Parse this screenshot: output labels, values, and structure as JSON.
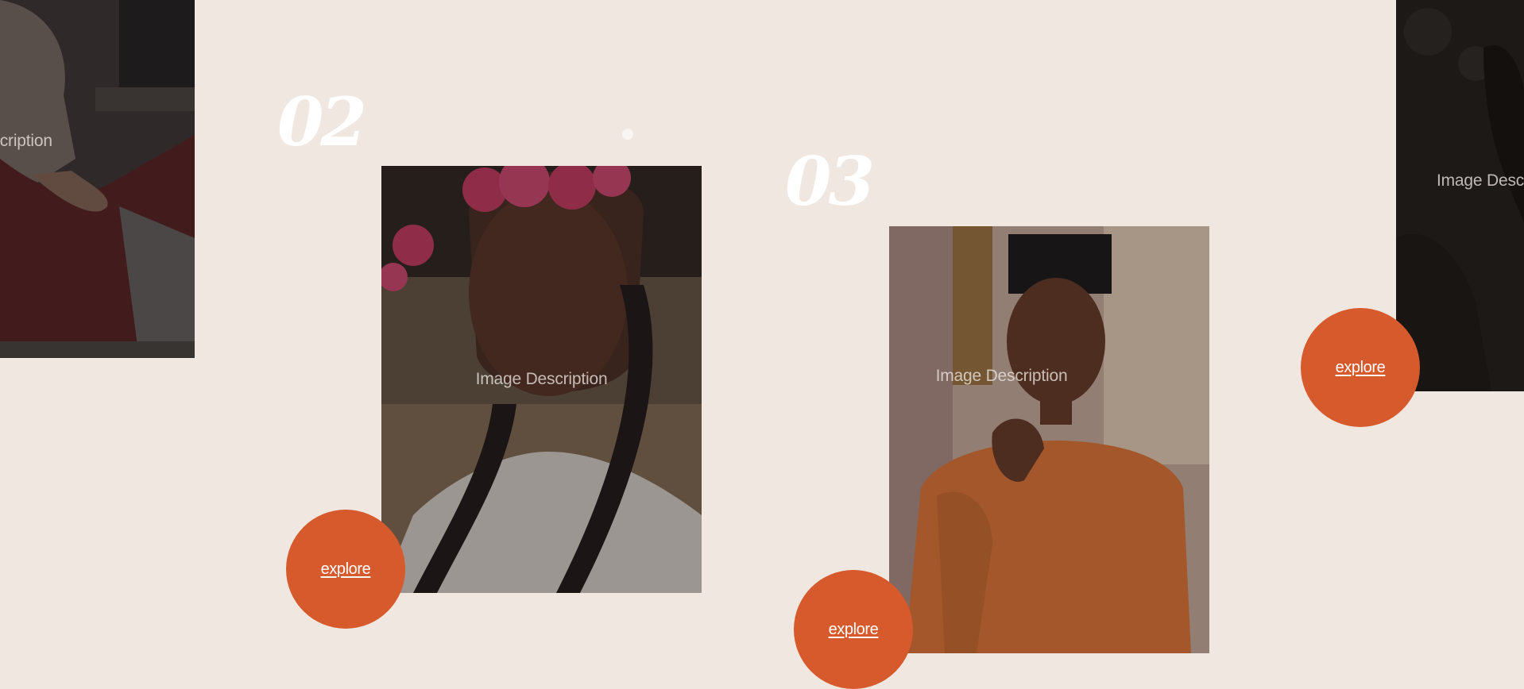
{
  "colors": {
    "page_background": "#efe7e0",
    "accent": "#d65a2b",
    "number_color": "#ffffff"
  },
  "slides": [
    {
      "number": "",
      "image_caption": "Image Description",
      "explore_label": ""
    },
    {
      "number": "02",
      "image_caption": "Image Description",
      "explore_label": "explore"
    },
    {
      "number": "03",
      "image_caption": "Image Description",
      "explore_label": "explore"
    },
    {
      "number": "",
      "image_caption": "Image Description",
      "explore_label": "explore"
    }
  ]
}
